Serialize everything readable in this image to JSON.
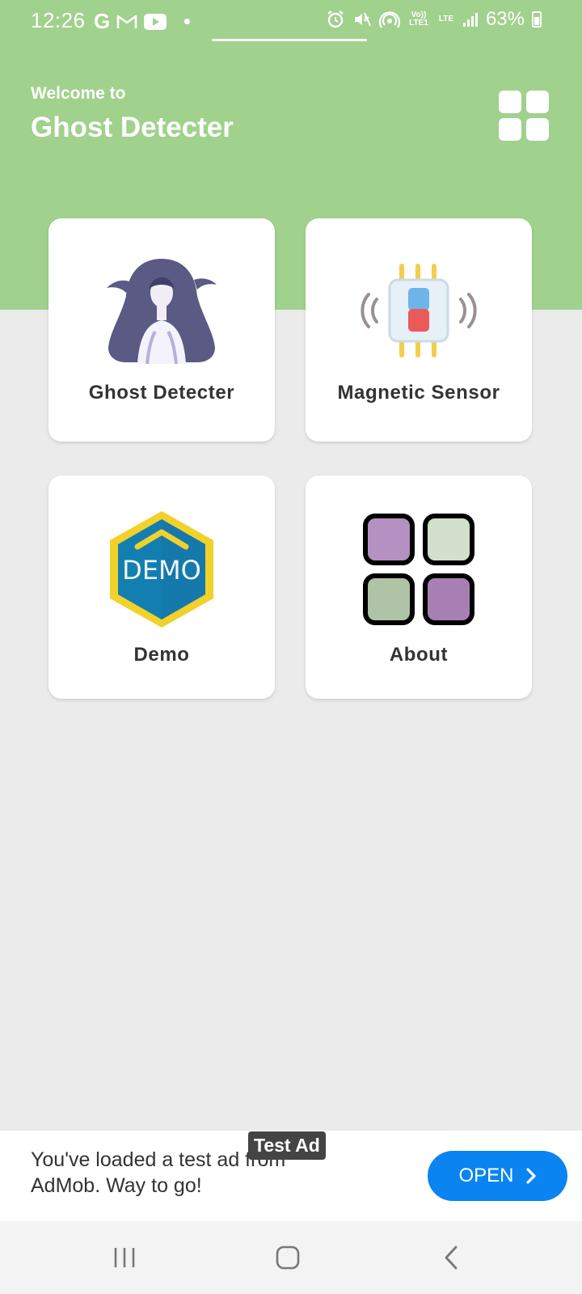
{
  "status_bar": {
    "time": "12:26",
    "g_icon": "G",
    "lte_top": "Vo)) LTE1",
    "lte_label": "LTE",
    "battery": "63%",
    "icons": [
      "google-icon",
      "gmail-icon",
      "youtube-icon",
      "alarm-icon",
      "mute-icon",
      "hotspot-icon",
      "signal-icon",
      "battery-icon"
    ]
  },
  "header": {
    "welcome": "Welcome to",
    "title": "Ghost Detecter",
    "bg_color": "#a0d18d"
  },
  "cards": [
    {
      "label": "Ghost Detecter",
      "icon": "ghost-girl-icon"
    },
    {
      "label": "Magnetic Sensor",
      "icon": "magnetic-sensor-icon"
    },
    {
      "label": "Demo",
      "icon": "demo-badge-icon",
      "badge_text": "DEMO"
    },
    {
      "label": "About",
      "icon": "grid-squares-icon"
    }
  ],
  "ad": {
    "badge": "Test Ad",
    "text": "You've loaded a test ad from AdMob. Way to go!",
    "button": "OPEN"
  },
  "nav": {
    "items": [
      "recent-apps-icon",
      "home-icon",
      "back-icon"
    ]
  }
}
